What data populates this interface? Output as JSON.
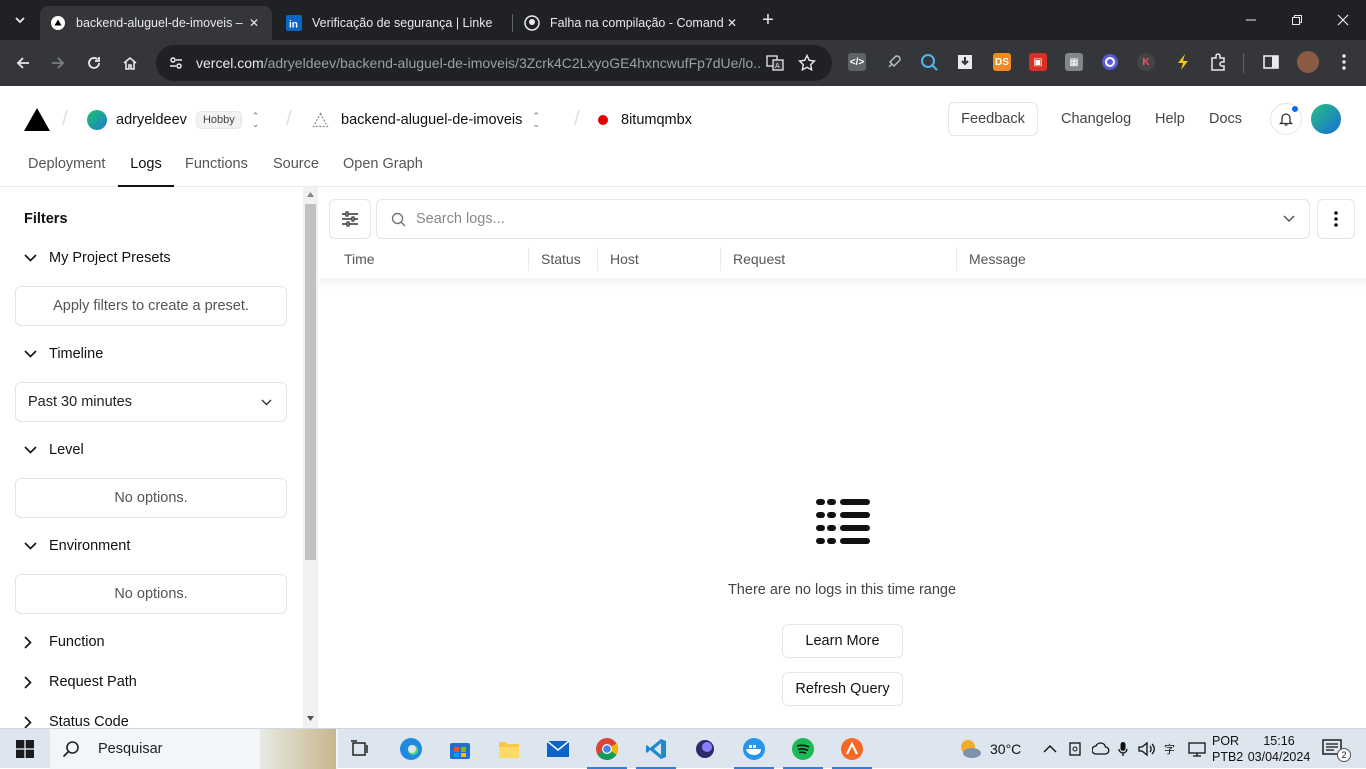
{
  "browser": {
    "tabs": [
      {
        "title": "backend-aluguel-de-imoveis – D",
        "icon": "vercel-triangle-icon",
        "active": true
      },
      {
        "title": "Verificação de segurança | Linke",
        "icon": "linkedin-icon",
        "active": false
      },
      {
        "title": "Falha na compilação - Comando",
        "icon": "github-icon",
        "active": false
      }
    ],
    "url_host": "vercel.com",
    "url_path": "/adryeldeev/backend-aluguel-de-imoveis/3Zcrk4C2LxyoGE4hxncwufFp7dUe/lo...",
    "extensions": [
      "code-ext",
      "rocket-ext",
      "search-ext",
      "download-ext",
      "DS",
      "red-ext",
      "grid-ext",
      "circle-ext",
      "K",
      "bolt-ext"
    ]
  },
  "header": {
    "team": "adryeldeev",
    "plan_badge": "Hobby",
    "project": "backend-aluguel-de-imoveis",
    "deployment": "8itumqmbx",
    "deployment_status_color": "#e00000",
    "feedback": "Feedback",
    "links": [
      "Changelog",
      "Help",
      "Docs"
    ]
  },
  "nav": {
    "tabs": [
      "Deployment",
      "Logs",
      "Functions",
      "Source",
      "Open Graph"
    ],
    "active": "Logs"
  },
  "sidebar": {
    "title": "Filters",
    "presets_heading": "My Project Presets",
    "presets_empty": "Apply filters to create a preset.",
    "timeline_heading": "Timeline",
    "timeline_value": "Past 30 minutes",
    "level_heading": "Level",
    "level_empty": "No options.",
    "environment_heading": "Environment",
    "environment_empty": "No options.",
    "collapsed_sections": [
      "Function",
      "Request Path",
      "Status Code"
    ]
  },
  "logs": {
    "search_placeholder": "Search logs...",
    "columns": [
      "Time",
      "Status",
      "Host",
      "Request",
      "Message"
    ],
    "empty_message": "There are no logs in this time range",
    "learn_more": "Learn More",
    "refresh": "Refresh Query"
  },
  "taskbar": {
    "search_label": "Pesquisar",
    "weather": "30°C",
    "lang_line1": "POR",
    "lang_line2": "PTB2",
    "time": "15:16",
    "date": "03/04/2024",
    "notifications": "2"
  }
}
